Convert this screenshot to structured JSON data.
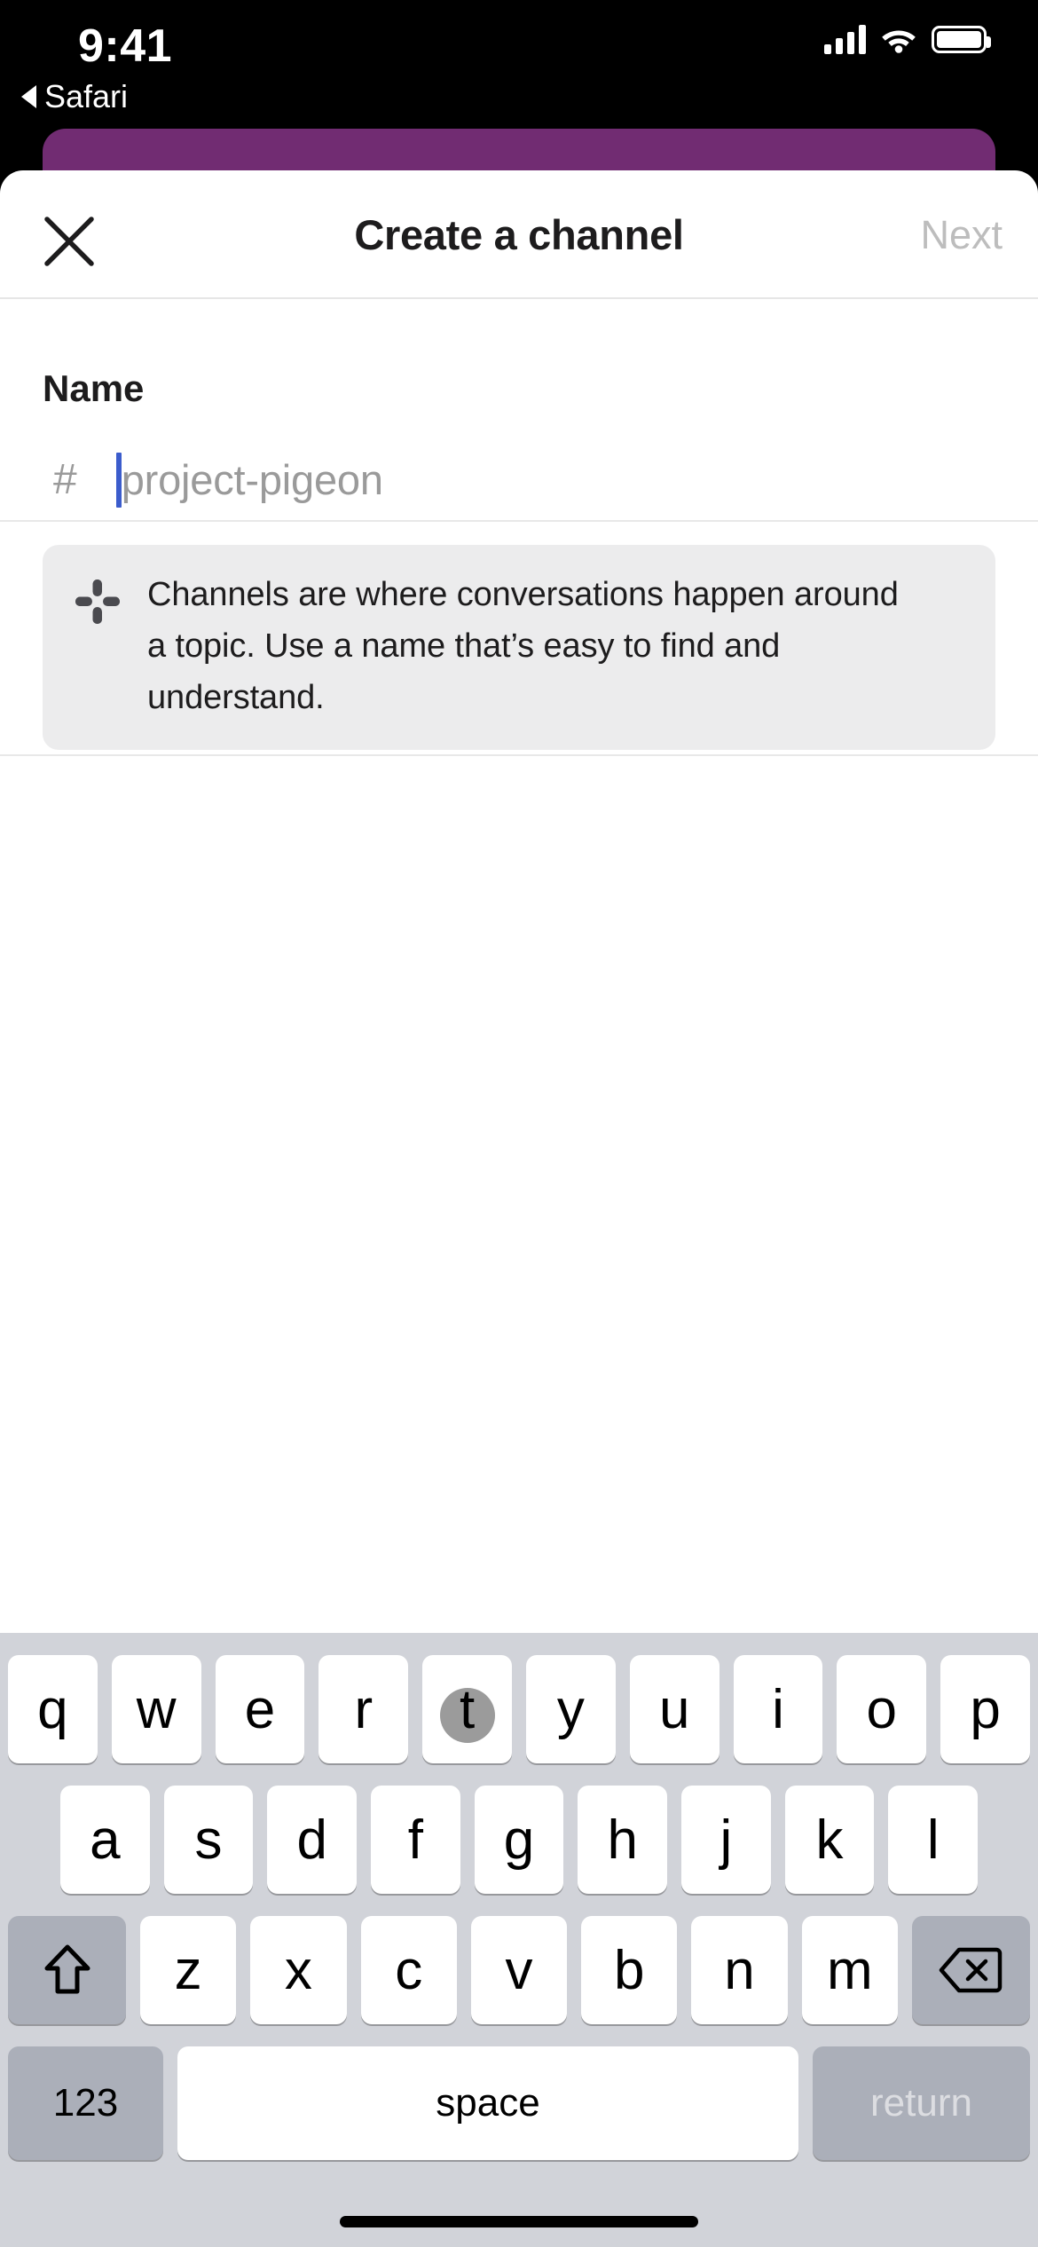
{
  "status_bar": {
    "time": "9:41",
    "back_label": "Safari",
    "back_icon": "triangle-left-icon",
    "signal_icon": "cellular-bars-icon",
    "wifi_icon": "wifi-icon",
    "battery_icon": "battery-icon"
  },
  "app": {
    "accent_purple": "#712c72",
    "cursor_color": "#3b5ccc"
  },
  "nav": {
    "close_icon": "close-x-icon",
    "title": "Create a channel",
    "next_label": "Next"
  },
  "form": {
    "name_label": "Name",
    "hash_prefix": "#",
    "name_value": "",
    "name_placeholder": "project-pigeon"
  },
  "info_card": {
    "logo_icon": "slack-logo-icon",
    "text": "Channels are where conversations happen around a topic. Use a name that’s easy to find and understand."
  },
  "keyboard": {
    "row1": [
      "q",
      "w",
      "e",
      "r",
      "t",
      "y",
      "u",
      "i",
      "o",
      "p"
    ],
    "row2": [
      "a",
      "s",
      "d",
      "f",
      "g",
      "h",
      "j",
      "k",
      "l"
    ],
    "row3": [
      "z",
      "x",
      "c",
      "v",
      "b",
      "n",
      "m"
    ],
    "shift_icon": "shift-arrow-icon",
    "backspace_icon": "backspace-delete-icon",
    "numbers_label": "123",
    "space_label": "space",
    "return_label": "return",
    "pressed_key": "t",
    "home_indicator": "home-indicator"
  }
}
